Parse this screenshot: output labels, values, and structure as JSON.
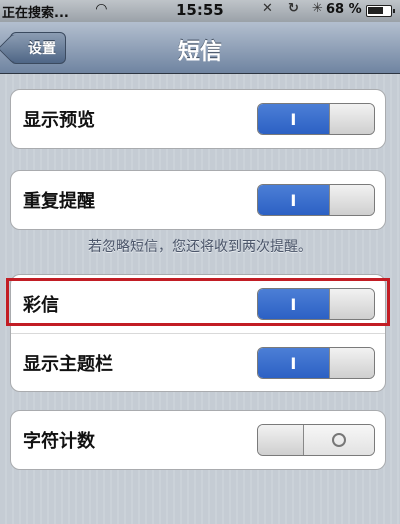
{
  "status_bar": {
    "carrier": "正在搜索...",
    "time": "15:55",
    "battery": "68 %"
  },
  "nav": {
    "back_label": "设置",
    "title": "短信"
  },
  "settings": {
    "preview_label": "显示预览",
    "preview_state": "on",
    "repeat_label": "重复提醒",
    "repeat_state": "on",
    "repeat_note": "若忽略短信，您还将收到两次提醒。",
    "mms_label": "彩信",
    "mms_state": "on",
    "subject_label": "显示主题栏",
    "subject_state": "on",
    "count_label": "字符计数",
    "count_state": "off"
  },
  "toggle_on_glyph": "I",
  "icons": {
    "wifi": "wifi-icon",
    "mute": "mute-icon",
    "lock": "rotation-lock-icon",
    "bluetooth": "bluetooth-icon",
    "battery": "battery-icon"
  },
  "colors": {
    "toggle_on": "#2c61c4",
    "highlight": "#c21d24",
    "nav_bar": "#6f84a1"
  }
}
